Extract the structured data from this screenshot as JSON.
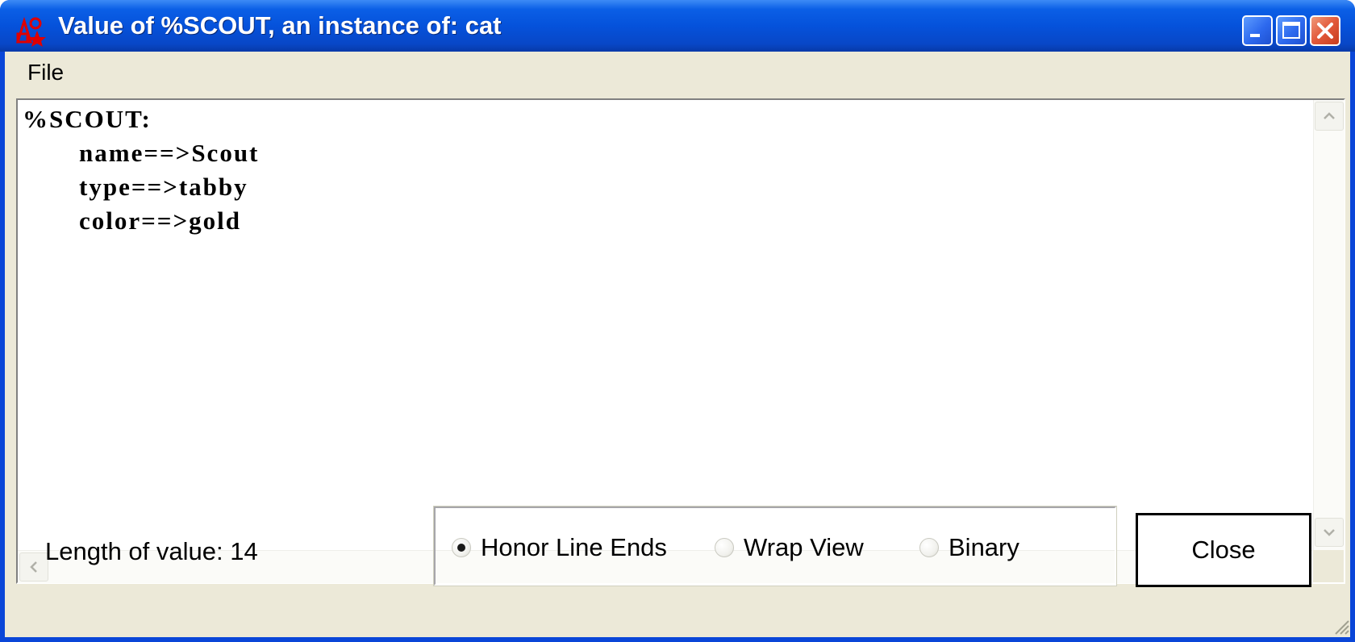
{
  "window": {
    "title": "Value of %SCOUT, an instance of: cat",
    "controls": [
      "minimize-icon",
      "maximize-icon",
      "close-icon"
    ]
  },
  "menu": {
    "file": "File"
  },
  "content": {
    "heading": "%SCOUT:",
    "lines": [
      "name==>Scout",
      "type==>tabby",
      "color==>gold"
    ]
  },
  "status": {
    "length_label": "Length of value: 14"
  },
  "view_options": {
    "selected": "Honor Line Ends",
    "items": [
      {
        "label": "Honor Line Ends",
        "selected": true
      },
      {
        "label": "Wrap View",
        "selected": false
      },
      {
        "label": "Binary",
        "selected": false
      }
    ]
  },
  "buttons": {
    "close_label": "Close"
  },
  "colors": {
    "titlebar": "#0552db",
    "client": "#ece9d8",
    "close_button": "#e2593a"
  }
}
